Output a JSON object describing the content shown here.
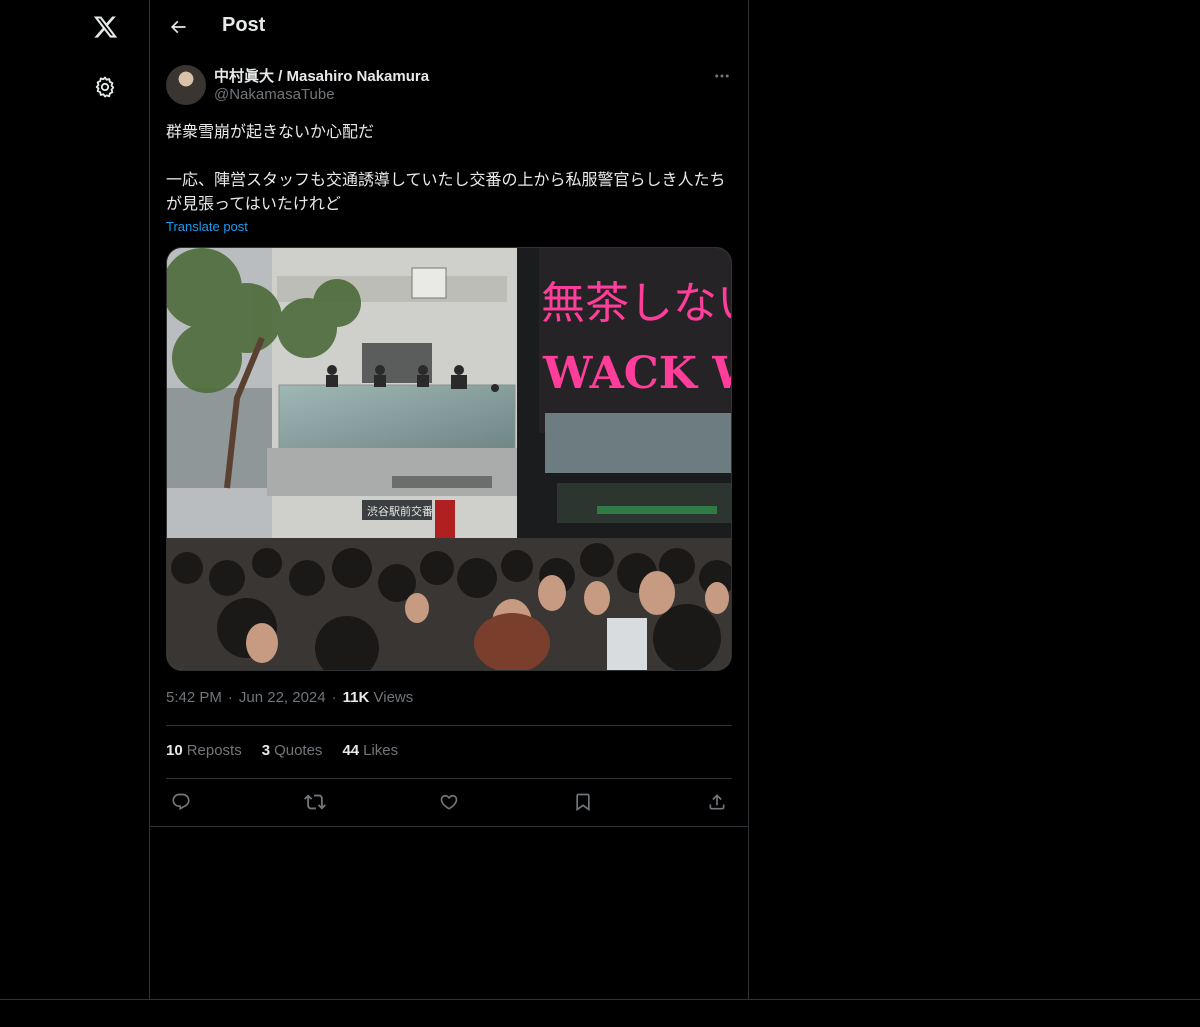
{
  "sidebar": {
    "logo_icon": "x-logo-icon",
    "settings_icon": "gear-icon"
  },
  "header": {
    "title": "Post",
    "back_icon": "arrow-left-icon"
  },
  "post": {
    "author": {
      "name": "中村眞大 / Masahiro Nakamura",
      "handle": "@NakamasaTube"
    },
    "text_line1": "群衆雪崩が起きないか心配だ",
    "text_line2": "一応、陣営スタッフも交通誘導していたし交番の上から私服警官らしき人たちが見張ってはいたけれど",
    "translate_label": "Translate post",
    "image": {
      "billboard_text_1": "無茶しないと",
      "billboard_text_2": "WACK WACK",
      "sign_text": "渋谷駅前交番"
    },
    "time": "5:42 PM",
    "date": "Jun 22, 2024",
    "views_count": "11K",
    "views_label": "Views",
    "reposts_count": "10",
    "reposts_label": "Reposts",
    "quotes_count": "3",
    "quotes_label": "Quotes",
    "likes_count": "44",
    "likes_label": "Likes"
  },
  "actions": {
    "reply_icon": "reply-icon",
    "repost_icon": "repost-icon",
    "like_icon": "heart-icon",
    "bookmark_icon": "bookmark-icon",
    "share_icon": "share-icon"
  },
  "colors": {
    "background": "#000000",
    "text": "#e7e9ea",
    "muted": "#71767b",
    "link": "#1d9bf0",
    "border": "#2f3336",
    "billboard_pink": "#ff3d9a"
  }
}
